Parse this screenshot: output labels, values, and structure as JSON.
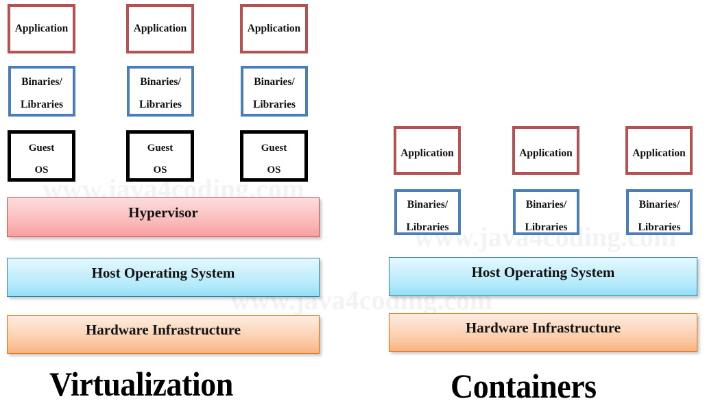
{
  "watermark": {
    "text": "www.java4coding.com",
    "color": "#f3f3f3",
    "occurrences": 3
  },
  "colors": {
    "application_border": "#b75050",
    "binaries_border": "#4a7ebb",
    "guest_os_border": "#000000",
    "hypervisor_fill": "#fbb4b4",
    "hypervisor_border": "#c0504d",
    "host_os_fill": "#b4eafb",
    "host_os_border": "#31859c",
    "hardware_fill": "#fbc9a4",
    "hardware_border": "#e36c0a",
    "text": "#111111"
  },
  "diagrams": [
    {
      "id": "virtualization",
      "title": "Virtualization",
      "stacks": [
        {
          "id": "vm-1",
          "boxes": [
            {
              "type": "application",
              "lines": [
                "Application"
              ]
            },
            {
              "type": "binaries",
              "lines": [
                "Binaries/",
                "Libraries"
              ]
            },
            {
              "type": "guest-os",
              "lines": [
                "Guest",
                "OS"
              ]
            }
          ]
        },
        {
          "id": "vm-2",
          "boxes": [
            {
              "type": "application",
              "lines": [
                "Application"
              ]
            },
            {
              "type": "binaries",
              "lines": [
                "Binaries/",
                "Libraries"
              ]
            },
            {
              "type": "guest-os",
              "lines": [
                "Guest",
                "OS"
              ]
            }
          ]
        },
        {
          "id": "vm-3",
          "boxes": [
            {
              "type": "application",
              "lines": [
                "Application"
              ]
            },
            {
              "type": "binaries",
              "lines": [
                "Binaries/",
                "Libraries"
              ]
            },
            {
              "type": "guest-os",
              "lines": [
                "Guest",
                "OS"
              ]
            }
          ]
        }
      ],
      "bands": [
        {
          "id": "hypervisor",
          "label": "Hypervisor"
        },
        {
          "id": "host-os",
          "label": "Host Operating System"
        },
        {
          "id": "hardware",
          "label": "Hardware Infrastructure"
        }
      ]
    },
    {
      "id": "containers",
      "title": "Containers",
      "stacks": [
        {
          "id": "container-1",
          "boxes": [
            {
              "type": "application",
              "lines": [
                "Application"
              ]
            },
            {
              "type": "binaries",
              "lines": [
                "Binaries/",
                "Libraries"
              ]
            }
          ]
        },
        {
          "id": "container-2",
          "boxes": [
            {
              "type": "application",
              "lines": [
                "Application"
              ]
            },
            {
              "type": "binaries",
              "lines": [
                "Binaries/",
                "Libraries"
              ]
            }
          ]
        },
        {
          "id": "container-3",
          "boxes": [
            {
              "type": "application",
              "lines": [
                "Application"
              ]
            },
            {
              "type": "binaries",
              "lines": [
                "Binaries/",
                "Libraries"
              ]
            }
          ]
        }
      ],
      "bands": [
        {
          "id": "host-os",
          "label": "Host Operating System"
        },
        {
          "id": "hardware",
          "label": "Hardware Infrastructure"
        }
      ]
    }
  ]
}
